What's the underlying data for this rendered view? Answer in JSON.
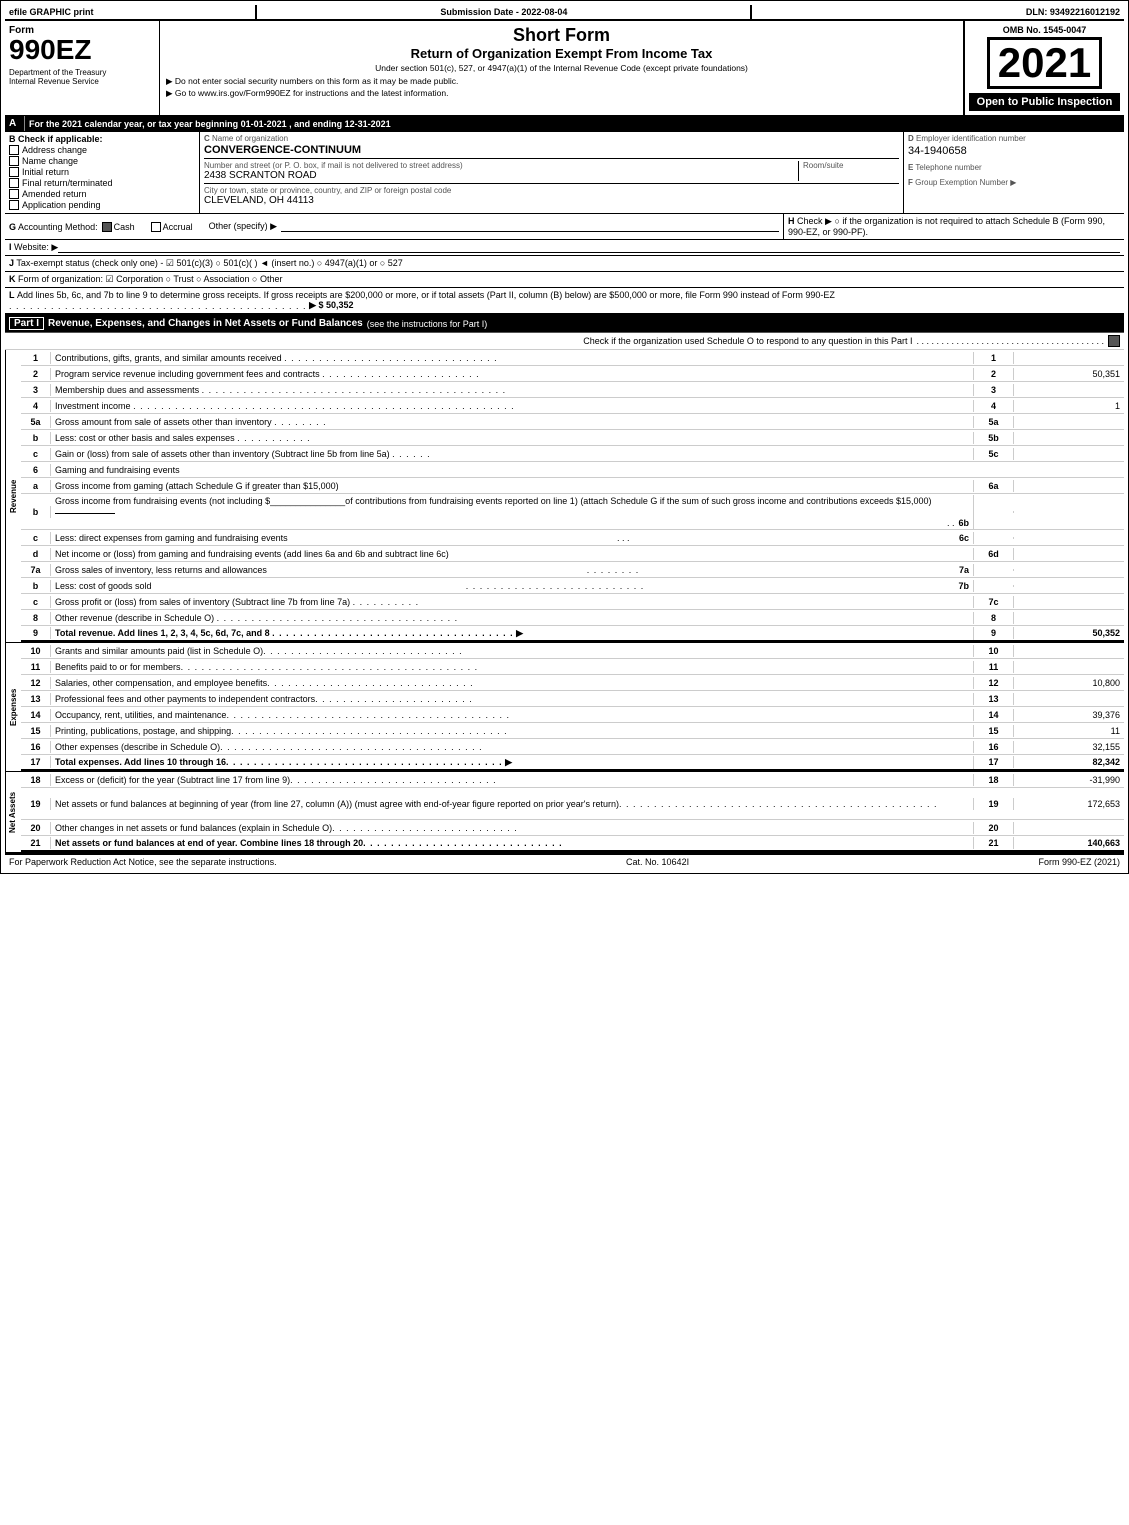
{
  "top_bar": {
    "efile": "efile GRAPHIC print",
    "submission": "Submission Date - 2022-08-04",
    "dln": "DLN: 93492216012192"
  },
  "header": {
    "form_number": "990EZ",
    "form_label": "Form",
    "form_title": "Short Form",
    "form_subtitle": "Return of Organization Exempt From Income Tax",
    "under_section": "Under section 501(c), 527, or 4947(a)(1) of the Internal Revenue Code (except private foundations)",
    "no_ssn": "▶ Do not enter social security numbers on this form as it may be made public.",
    "goto": "▶ Go to www.irs.gov/Form990EZ for instructions and the latest information.",
    "omb": "OMB No. 1545-0047",
    "year": "2021",
    "open_to_public": "Open to Public Inspection",
    "dept": "Department of the Treasury",
    "treasury": "Internal Revenue Service"
  },
  "section_a": {
    "label": "A",
    "text": "For the 2021 calendar year, or tax year beginning 01-01-2021 , and ending 12-31-2021"
  },
  "section_b": {
    "label": "B",
    "text": "Check if applicable:",
    "options": [
      {
        "id": "address_change",
        "label": "Address change",
        "checked": false
      },
      {
        "id": "name_change",
        "label": "Name change",
        "checked": false
      },
      {
        "id": "initial_return",
        "label": "Initial return",
        "checked": false
      },
      {
        "id": "final_return",
        "label": "Final return/terminated",
        "checked": false
      },
      {
        "id": "amended_return",
        "label": "Amended return",
        "checked": false
      },
      {
        "id": "app_pending",
        "label": "Application pending",
        "checked": false
      }
    ]
  },
  "section_c": {
    "label": "C",
    "name_label": "Name of organization",
    "org_name": "CONVERGENCE-CONTINUUM",
    "address_label": "Number and street (or P. O. box, if mail is not delivered to street address)",
    "address": "2438 SCRANTON ROAD",
    "room_label": "Room/suite",
    "room": "",
    "city_label": "City or town, state or province, country, and ZIP or foreign postal code",
    "city": "CLEVELAND, OH  44113"
  },
  "section_d": {
    "label": "D",
    "text": "Employer identification number",
    "ein": "34-1940658"
  },
  "section_e": {
    "label": "E",
    "text": "Telephone number"
  },
  "section_f": {
    "label": "F",
    "text": "Group Exemption Number",
    "arrow": "▶"
  },
  "section_g": {
    "label": "G",
    "text": "Accounting Method:",
    "cash": "Cash",
    "cash_checked": true,
    "accrual": "Accrual",
    "other": "Other (specify) ▶"
  },
  "section_h": {
    "label": "H",
    "text": "Check ▶ ○ if the organization is not required to attach Schedule B (Form 990, 990-EZ, or 990-PF)."
  },
  "section_i": {
    "label": "I",
    "text": "Website: ▶"
  },
  "section_j": {
    "label": "J",
    "text": "Tax-exempt status (check only one) - ☑ 501(c)(3) ○ 501(c)(  ) ◄ (insert no.) ○ 4947(a)(1) or ○ 527"
  },
  "section_k": {
    "label": "K",
    "text": "Form of organization: ☑ Corporation ○ Trust ○ Association ○ Other"
  },
  "section_l": {
    "label": "L",
    "text": "Add lines 5b, 6c, and 7b to line 9 to determine gross receipts. If gross receipts are $200,000 or more, or if total assets (Part II, column (B) below) are $500,000 or more, file Form 990 instead of Form 990-EZ",
    "dots": ". . . . . . . . . . . . . . . . . . . . . . . . . . . . . . . . . . . . . . . . . . .",
    "arrow": "▶",
    "amount": "$ 50,352"
  },
  "part1": {
    "label": "Part I",
    "title": "Revenue, Expenses, and Changes in Net Assets or Fund Balances",
    "see_instructions": "(see the instructions for Part I)",
    "check_schedule_o": "Check if the organization used Schedule O to respond to any question in this Part I",
    "dots": ". . . . . . . . . . . . . . . . . . . . . . . . . . . . . . . . . . . . . .",
    "checkbox_checked": true,
    "rows": [
      {
        "num": "1",
        "desc": "Contributions, gifts, grants, and similar amounts received",
        "dots": ". . . . . . . . . . . . . . . . . . . . . . . . . . . . . . .",
        "linenum": "1",
        "amount": ""
      },
      {
        "num": "2",
        "desc": "Program service revenue including government fees and contracts",
        "dots": ". . . . . . . . . . . . . . . . . . . . . . .",
        "linenum": "2",
        "amount": "50,351"
      },
      {
        "num": "3",
        "desc": "Membership dues and assessments",
        "dots": ". . . . . . . . . . . . . . . . . . . . . . . . . . . . . . . . . . . . . . . . . . . .",
        "linenum": "3",
        "amount": ""
      },
      {
        "num": "4",
        "desc": "Investment income",
        "dots": ". . . . . . . . . . . . . . . . . . . . . . . . . . . . . . . . . . . . . . . . . . . . . . . . . . . . . . .",
        "linenum": "4",
        "amount": "1"
      }
    ],
    "rows_5": [
      {
        "num": "5a",
        "desc": "Gross amount from sale of assets other than inventory",
        "dots": ". . . . . . . .",
        "sub_col": "5a",
        "sub_val": ""
      },
      {
        "num": "b",
        "desc": "Less: cost or other basis and sales expenses",
        "dots": ". . . . . . . . . . .",
        "sub_col": "5b",
        "sub_val": ""
      },
      {
        "num": "c",
        "desc": "Gain or (loss) from sale of assets other than inventory (Subtract line 5b from line 5a)",
        "dots": ". . . . . .",
        "linenum": "5c",
        "amount": ""
      }
    ],
    "rows_6": {
      "num": "6",
      "desc": "Gaming and fundraising events",
      "sub_rows": [
        {
          "letter": "a",
          "desc": "Gross income from gaming (attach Schedule G if greater than $15,000)",
          "sub_col": "6a",
          "sub_val": ""
        },
        {
          "letter": "b",
          "desc": "Gross income from fundraising events (not including $_______________of contributions from fundraising events reported on line 1) (attach Schedule G if the sum of such gross income and contributions exceeds $15,000)",
          "dots": ". .",
          "sub_col": "6b",
          "sub_val": ""
        },
        {
          "letter": "c",
          "desc": "Less: direct expenses from gaming and fundraising events",
          "dots": ". . .",
          "sub_col": "6c",
          "sub_val": ""
        },
        {
          "letter": "d",
          "desc": "Net income or (loss) from gaming and fundraising events (add lines 6a and 6b and subtract line 6c)",
          "linenum": "6d",
          "amount": ""
        }
      ]
    },
    "rows_7": [
      {
        "num": "7a",
        "desc": "Gross sales of inventory, less returns and allowances",
        "dots": ". . . . . . . .",
        "sub_col": "7a",
        "sub_val": ""
      },
      {
        "num": "b",
        "desc": "Less: cost of goods sold",
        "dots": ". . . . . . . . . . . . . . . . . . . . . . . . . .",
        "sub_col": "7b",
        "sub_val": ""
      },
      {
        "num": "c",
        "desc": "Gross profit or (loss) from sales of inventory (Subtract line 7b from line 7a)",
        "dots": ". . . . . . . . . .",
        "linenum": "7c",
        "amount": ""
      }
    ],
    "rows_89": [
      {
        "num": "8",
        "desc": "Other revenue (describe in Schedule O)",
        "dots": ". . . . . . . . . . . . . . . . . . . . . . . . . . . . . . . . . . .",
        "linenum": "8",
        "amount": ""
      },
      {
        "num": "9",
        "desc": "Total revenue. Add lines 1, 2, 3, 4, 5c, 6d, 7c, and 8",
        "dots": ". . . . . . . . . . . . . . . . . . . . . . . . . . . . . . . . . . .",
        "arrow": "▶",
        "linenum": "9",
        "amount": "50,352",
        "bold": true
      }
    ]
  },
  "expenses": {
    "label": "Expenses",
    "rows": [
      {
        "num": "10",
        "desc": "Grants and similar amounts paid (list in Schedule O)",
        "dots": ". . . . . . . . . . . . . . . . . . . . . . . . . . . . .",
        "linenum": "10",
        "amount": ""
      },
      {
        "num": "11",
        "desc": "Benefits paid to or for members",
        "dots": ". . . . . . . . . . . . . . . . . . . . . . . . . . . . . . . . . . . . . . . . . . .",
        "linenum": "11",
        "amount": ""
      },
      {
        "num": "12",
        "desc": "Salaries, other compensation, and employee benefits",
        "dots": ". . . . . . . . . . . . . . . . . . . . . . . . . . . . . .",
        "linenum": "12",
        "amount": "10,800"
      },
      {
        "num": "13",
        "desc": "Professional fees and other payments to independent contractors",
        "dots": ". . . . . . . . . . . . . . . . . . . . . . .",
        "linenum": "13",
        "amount": ""
      },
      {
        "num": "14",
        "desc": "Occupancy, rent, utilities, and maintenance",
        "dots": ". . . . . . . . . . . . . . . . . . . . . . . . . . . . . . . . . . . . . . . . .",
        "linenum": "14",
        "amount": "39,376"
      },
      {
        "num": "15",
        "desc": "Printing, publications, postage, and shipping",
        "dots": ". . . . . . . . . . . . . . . . . . . . . . . . . . . . . . . . . . . . . . . .",
        "linenum": "15",
        "amount": "11"
      },
      {
        "num": "16",
        "desc": "Other expenses (describe in Schedule O)",
        "dots": ". . . . . . . . . . . . . . . . . . . . . . . . . . . . . . . . . . . . . .",
        "linenum": "16",
        "amount": "32,155"
      },
      {
        "num": "17",
        "desc": "Total expenses. Add lines 10 through 16",
        "dots": ". . . . . . . . . . . . . . . . . . . . . . . . . . . . . . . . . . . . . . . .",
        "arrow": "▶",
        "linenum": "17",
        "amount": "82,342",
        "bold": true
      }
    ]
  },
  "net_assets": {
    "label": "Net Assets",
    "rows": [
      {
        "num": "18",
        "desc": "Excess or (deficit) for the year (Subtract line 17 from line 9)",
        "dots": ". . . . . . . . . . . . . . . . . . . . . . . . . . . . . .",
        "linenum": "18",
        "amount": "-31,990"
      },
      {
        "num": "19",
        "desc": "Net assets or fund balances at beginning of year (from line 27, column (A)) (must agree with end-of-year figure reported on prior year's return)",
        "dots": ". . . . . . . . . . . . . . . . . . . . . . . . . . . . . . . . . . . . . . . . . . . . . .",
        "linenum": "19",
        "amount": "172,653"
      },
      {
        "num": "20",
        "desc": "Other changes in net assets or fund balances (explain in Schedule O)",
        "dots": ". . . . . . . . . . . . . . . . . . . . . . . . . . .",
        "linenum": "20",
        "amount": ""
      },
      {
        "num": "21",
        "desc": "Net assets or fund balances at end of year. Combine lines 18 through 20",
        "dots": ". . . . . . . . . . . . . . . . . . . . . . . . . . . . .",
        "linenum": "21",
        "amount": "140,663",
        "bold": true
      }
    ]
  },
  "footer": {
    "paperwork": "For Paperwork Reduction Act Notice, see the separate instructions.",
    "cat_no": "Cat. No. 10642I",
    "form_ref": "Form 990-EZ (2021)"
  }
}
